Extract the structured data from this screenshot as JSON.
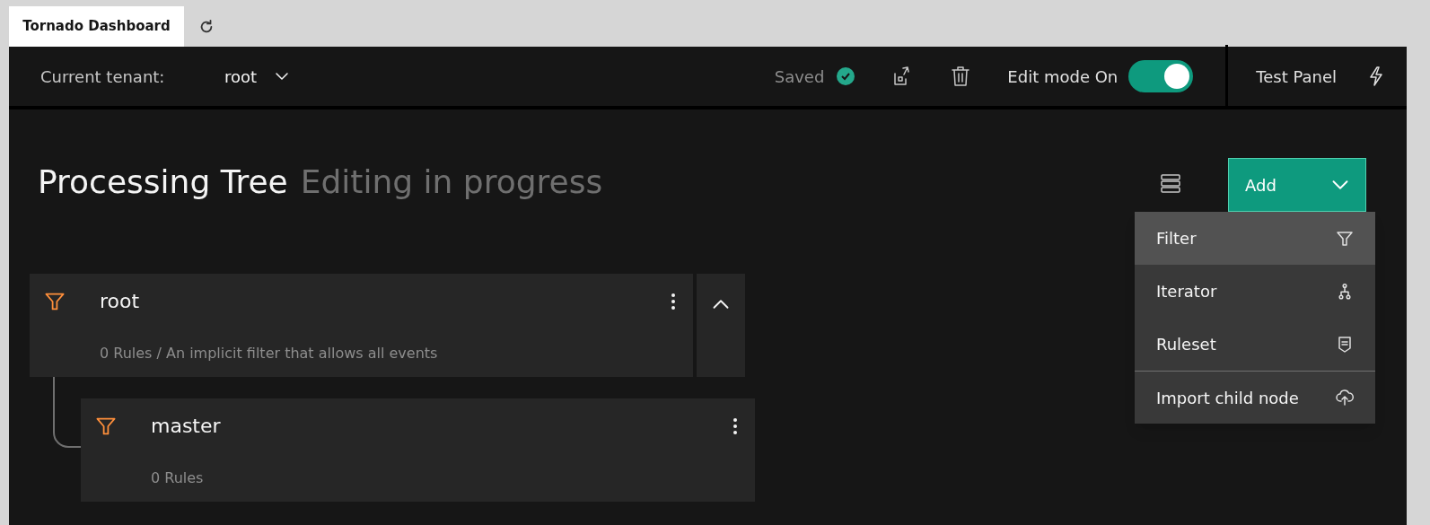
{
  "tabs": [
    {
      "label": "Tornado Dashboard",
      "selected": true
    }
  ],
  "header": {
    "tenant_label": "Current tenant:",
    "tenant": "root",
    "status": "Saved",
    "edit_mode_label": "Edit mode On",
    "edit_mode_on": true,
    "test_panel": "Test Panel"
  },
  "page": {
    "title": "Processing Tree",
    "subtitle": "Editing in progress"
  },
  "add_button": {
    "label": "Add",
    "expanded": true
  },
  "add_menu": [
    {
      "label": "Filter",
      "kind": "filter",
      "selected": true
    },
    {
      "label": "Iterator",
      "kind": "iterator",
      "selected": false
    },
    {
      "label": "Ruleset",
      "kind": "ruleset",
      "selected": false
    },
    {
      "label": "Import child node",
      "kind": "import",
      "selected": false
    }
  ],
  "tree": [
    {
      "name": "root",
      "description": "0 Rules / An implicit filter that allows all events",
      "expanded": true,
      "children": [
        {
          "name": "master",
          "description": "0 Rules"
        }
      ]
    }
  ]
}
